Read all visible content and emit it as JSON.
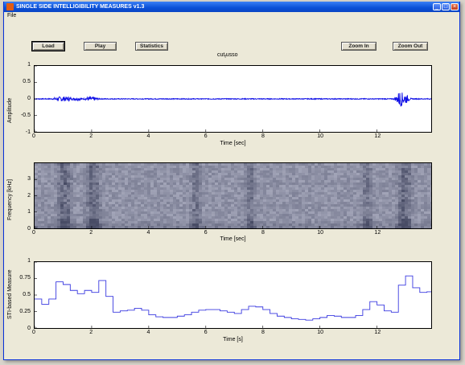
{
  "window": {
    "title": "SINGLE SIDE INTELLIGIBILITY MEASURES v1.3",
    "controls": {
      "minimize": "_",
      "maximize": "□",
      "close": "×"
    }
  },
  "menu": {
    "file": "File"
  },
  "toolbar": {
    "load_label": "Load",
    "play_label": "Play",
    "statistics_label": "Statistics",
    "zoom_in_label": "Zoom In",
    "zoom_out_label": "Zoom Out"
  },
  "file_title": {
    "main": "cut",
    "sub": "f",
    "rest": "usso"
  },
  "colors": {
    "waveform": "#1010e6",
    "sti_line": "#3a3ae0",
    "spectrogram_bg": "#8a90aa",
    "titlebar": "#0a4fd6"
  },
  "chart_data": [
    {
      "type": "line",
      "name": "waveform",
      "xlabel": "Time [sec]",
      "ylabel": "Amplitude",
      "xlim": [
        0,
        13.9
      ],
      "ylim": [
        -1,
        1
      ],
      "xticks": [
        "0",
        "2",
        "4",
        "6",
        "8",
        "10",
        "12"
      ],
      "yticks": [
        "1",
        "0.5",
        "0",
        "-0.5",
        "-1"
      ],
      "bursts": [
        {
          "t": 0.8,
          "amp": 0.05
        },
        {
          "t": 1.0,
          "amp": 0.06
        },
        {
          "t": 1.2,
          "amp": 0.05
        },
        {
          "t": 1.5,
          "amp": 0.04
        },
        {
          "t": 1.9,
          "amp": 0.05
        },
        {
          "t": 2.1,
          "amp": 0.04
        },
        {
          "t": 12.8,
          "amp": 0.22
        },
        {
          "t": 13.0,
          "amp": 0.12
        }
      ]
    },
    {
      "type": "heatmap",
      "name": "spectrogram",
      "xlabel": "Time [sec]",
      "ylabel": "Frequency [kHz]",
      "xlim": [
        0,
        13.9
      ],
      "ylim": [
        0,
        4
      ],
      "xticks": [
        "0",
        "2",
        "4",
        "6",
        "8",
        "10",
        "12"
      ],
      "yticks": [
        "3",
        "2",
        "1",
        "0"
      ]
    },
    {
      "type": "line",
      "name": "sti",
      "xlabel": "Time [s]",
      "ylabel": "STI-based Measure",
      "xlim": [
        0,
        13.9
      ],
      "ylim": [
        0,
        1
      ],
      "xticks": [
        "0",
        "2",
        "4",
        "6",
        "8",
        "10",
        "12"
      ],
      "yticks": [
        "1",
        "0.75",
        "0.5",
        "0.25",
        "0"
      ],
      "x": [
        0,
        0.25,
        0.5,
        0.75,
        1.0,
        1.25,
        1.5,
        1.75,
        2.0,
        2.25,
        2.5,
        2.75,
        3.0,
        3.25,
        3.5,
        3.75,
        4.0,
        4.25,
        4.5,
        4.75,
        5.0,
        5.25,
        5.5,
        5.75,
        6.0,
        6.25,
        6.5,
        6.75,
        7.0,
        7.25,
        7.5,
        7.75,
        8.0,
        8.25,
        8.5,
        8.75,
        9.0,
        9.25,
        9.5,
        9.75,
        10.0,
        10.25,
        10.5,
        10.75,
        11.0,
        11.25,
        11.5,
        11.75,
        12.0,
        12.25,
        12.5,
        12.75,
        13.0,
        13.25,
        13.5,
        13.75
      ],
      "y": [
        0.44,
        0.36,
        0.44,
        0.7,
        0.66,
        0.57,
        0.52,
        0.57,
        0.54,
        0.72,
        0.48,
        0.24,
        0.26,
        0.27,
        0.3,
        0.27,
        0.2,
        0.17,
        0.16,
        0.16,
        0.18,
        0.2,
        0.24,
        0.27,
        0.28,
        0.28,
        0.26,
        0.24,
        0.22,
        0.28,
        0.33,
        0.32,
        0.28,
        0.22,
        0.18,
        0.16,
        0.14,
        0.13,
        0.12,
        0.14,
        0.16,
        0.19,
        0.18,
        0.16,
        0.16,
        0.19,
        0.28,
        0.4,
        0.35,
        0.26,
        0.24,
        0.65,
        0.79,
        0.61,
        0.54,
        0.55
      ]
    }
  ]
}
